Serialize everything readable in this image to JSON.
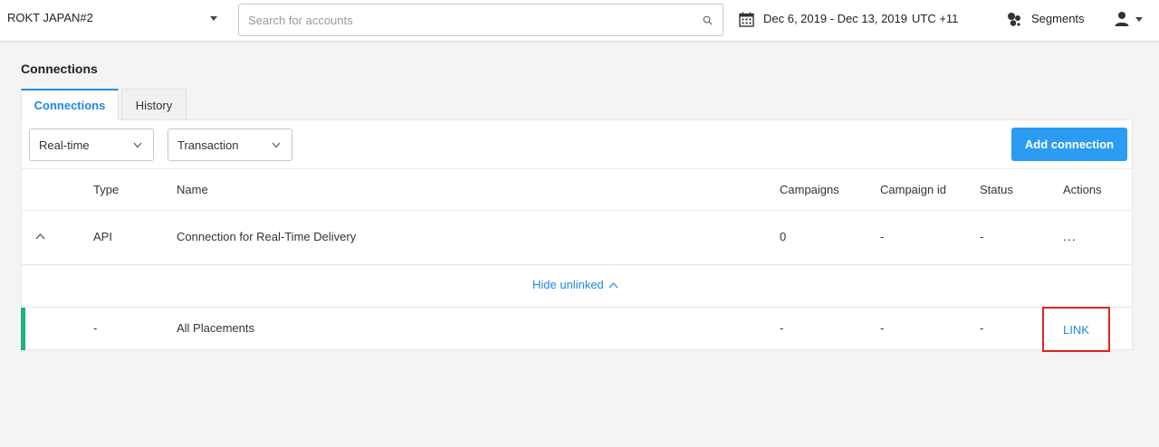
{
  "topbar": {
    "account_name": "ROKT JAPAN#2",
    "search_placeholder": "Search for accounts",
    "date_range": "Dec 6, 2019 - Dec 13, 2019",
    "timezone": "UTC +11",
    "segments_label": "Segments"
  },
  "page": {
    "title": "Connections"
  },
  "tabs": [
    {
      "label": "Connections",
      "active": true
    },
    {
      "label": "History",
      "active": false
    }
  ],
  "filters": {
    "delivery_type": "Real-time",
    "connection_kind": "Transaction"
  },
  "actions": {
    "add_connection_label": "Add connection"
  },
  "table": {
    "columns": [
      "Type",
      "Name",
      "Campaigns",
      "Campaign id",
      "Status",
      "Actions"
    ],
    "rows": [
      {
        "type": "API",
        "name": "Connection for Real-Time Delivery",
        "campaigns": "0",
        "campaign_id": "-",
        "status": "-",
        "actions": "..."
      }
    ],
    "hide_unlinked_label": "Hide unlinked",
    "placements": [
      {
        "type": "-",
        "name": "All Placements",
        "campaigns": "-",
        "campaign_id": "-",
        "status": "-",
        "action_label": "LINK"
      }
    ]
  },
  "colors": {
    "accent": "#2b9cf2",
    "link": "#1e88e5",
    "linked_indicator": "#1db37e",
    "highlight_box": "#e02424"
  }
}
